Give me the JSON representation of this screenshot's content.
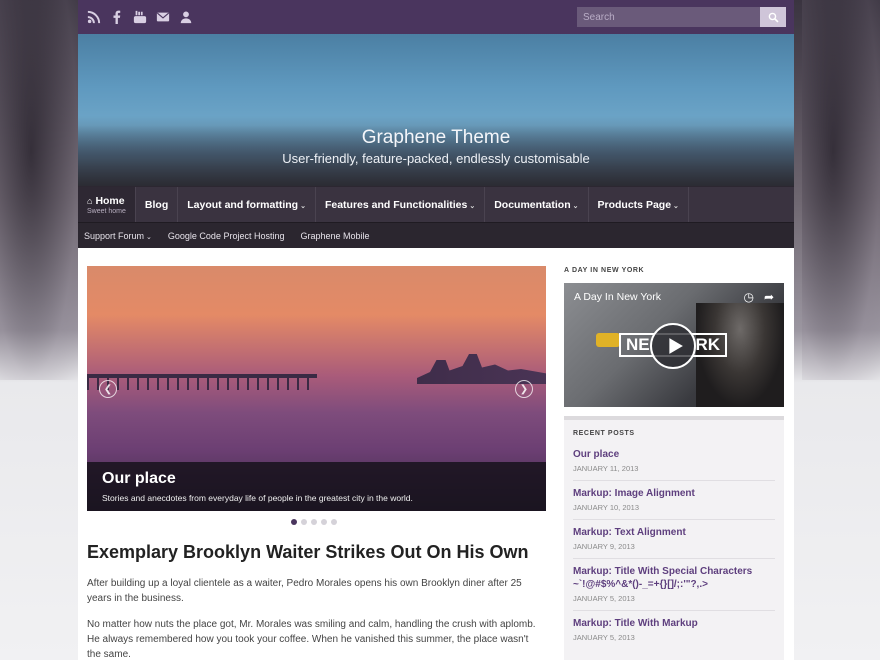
{
  "topbar": {
    "social_icons": [
      "rss-icon",
      "facebook-icon",
      "youtube-icon",
      "email-icon",
      "user-icon"
    ],
    "search_placeholder": "Search"
  },
  "header": {
    "title": "Graphene Theme",
    "tagline": "User-friendly, feature-packed, endlessly customisable"
  },
  "mainnav": {
    "items": [
      {
        "label": "Home",
        "sub": "Sweet home"
      },
      {
        "label": "Blog"
      },
      {
        "label": "Layout and formatting"
      },
      {
        "label": "Features and Functionalities"
      },
      {
        "label": "Documentation"
      },
      {
        "label": "Products Page"
      }
    ]
  },
  "secnav": {
    "items": [
      "Support Forum",
      "Google Code Project Hosting",
      "Graphene Mobile"
    ]
  },
  "slider": {
    "title": "Our place",
    "subtitle": "Stories and anecdotes from everyday life of people in the greatest city in the world.",
    "slide_count": 5,
    "active_slide": 1
  },
  "post": {
    "title": "Exemplary Brooklyn Waiter Strikes Out On His Own",
    "paragraphs": [
      "After building up a loyal clientele as a waiter, Pedro Morales opens his own Brooklyn diner after 25 years in the business.",
      "No matter how nuts the place got, Mr. Morales was smiling and calm, handling the crush with aplomb. He always remembered how you took your coffee. When he vanished this summer, the place wasn't the same."
    ]
  },
  "sidebar": {
    "video_widget_title": "A DAY IN NEW YORK",
    "video": {
      "title": "A Day In New York",
      "overlay_left": "NE",
      "overlay_right": "RK"
    },
    "recent_heading": "RECENT POSTS",
    "recent": [
      {
        "title": "Our place",
        "date": "JANUARY 11, 2013"
      },
      {
        "title": "Markup: Image Alignment",
        "date": "JANUARY 10, 2013"
      },
      {
        "title": "Markup: Text Alignment",
        "date": "JANUARY 9, 2013"
      },
      {
        "title": "Markup: Title With Special Characters ~`!@#$%^&*()-_=+{}[]/;:'\"?,.>",
        "date": "JANUARY 5, 2013"
      },
      {
        "title": "Markup: Title With Markup",
        "date": "JANUARY 5, 2013"
      }
    ]
  }
}
